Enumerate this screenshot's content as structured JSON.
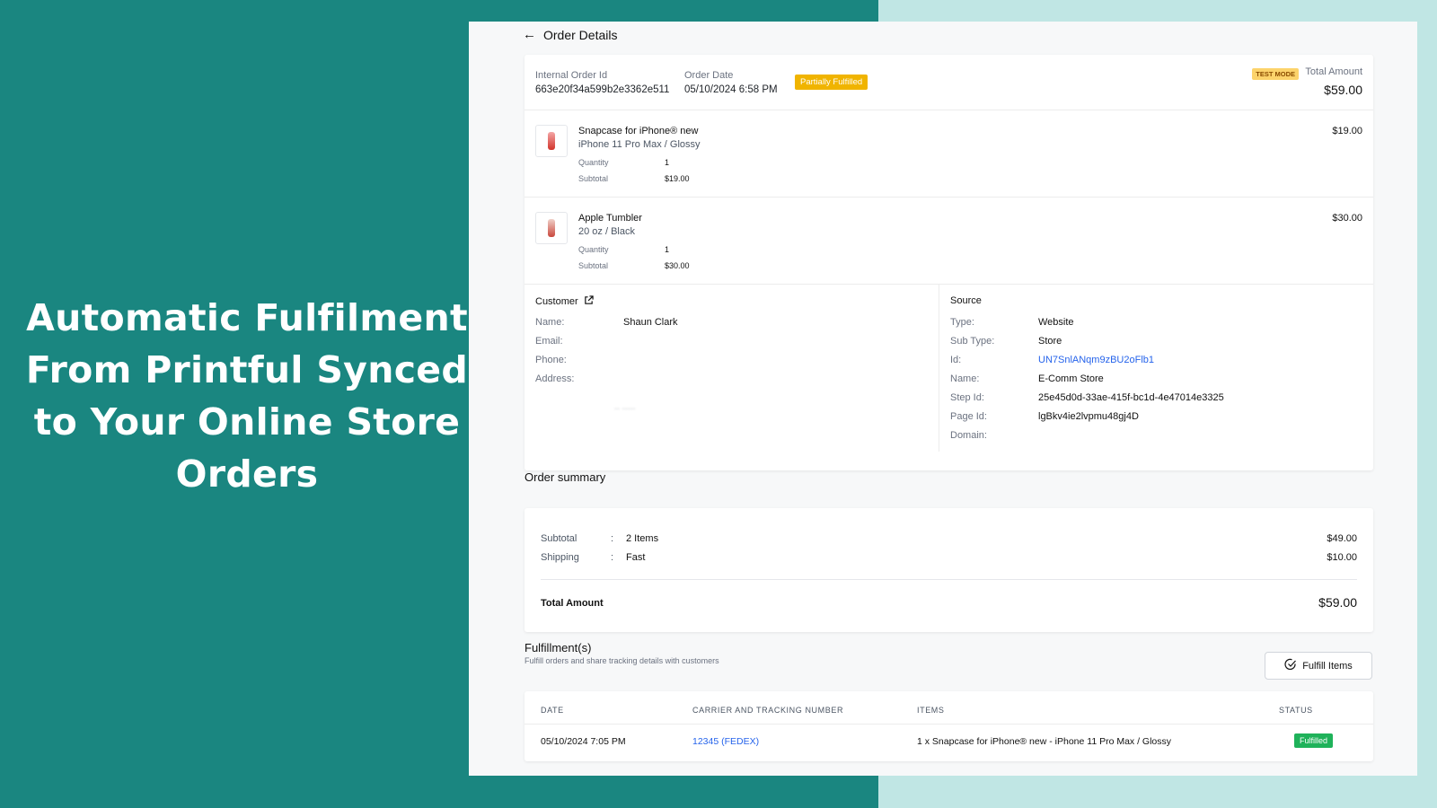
{
  "promo": {
    "headline": "Automatic Fulfilment From Printful Synced to Your Online Store Orders"
  },
  "header": {
    "back_icon": "arrow-left-icon",
    "title": "Order Details"
  },
  "order": {
    "internal_id_label": "Internal Order Id",
    "internal_id": "663e20f34a599b2e3362e511",
    "date_label": "Order Date",
    "date": "05/10/2024 6:58 PM",
    "status": "Partially Fulfilled",
    "test_mode": "TEST MODE",
    "total_label": "Total Amount",
    "total": "$59.00",
    "items": [
      {
        "name": "Snapcase for iPhone® new",
        "variant": "iPhone 11 Pro Max / Glossy",
        "qty_label": "Quantity",
        "qty": "1",
        "subtotal_label": "Subtotal",
        "subtotal": "$19.00",
        "price": "$19.00"
      },
      {
        "name": "Apple Tumbler",
        "variant": "20 oz / Black",
        "qty_label": "Quantity",
        "qty": "1",
        "subtotal_label": "Subtotal",
        "subtotal": "$30.00",
        "price": "$30.00"
      }
    ],
    "colors": {
      "partial_badge": "#f0b400",
      "fulfilled_badge": "#1fb25a",
      "link": "#2563eb",
      "brand_teal": "#1a8680"
    }
  },
  "customer": {
    "title": "Customer",
    "link_icon": "external-link-icon",
    "name_label": "Name:",
    "name": "Shaun Clark",
    "email_label": "Email:",
    "email": "",
    "phone_label": "Phone:",
    "phone": "",
    "address_label": "Address:",
    "address": "",
    "address_blur": "-- -----"
  },
  "source": {
    "title": "Source",
    "type_label": "Type:",
    "type": "Website",
    "subtype_label": "Sub Type:",
    "subtype": "Store",
    "id_label": "Id:",
    "id": "UN7SnlANqm9zBU2oFlb1",
    "name_label": "Name:",
    "name": "E-Comm Store",
    "step_label": "Step Id:",
    "step": "25e45d0d-33ae-415f-bc1d-4e47014e3325",
    "page_label": "Page Id:",
    "page": "lgBkv4ie2lvpmu48gj4D",
    "domain_label": "Domain:",
    "domain": ""
  },
  "summary": {
    "title": "Order summary",
    "subtotal_label": "Subtotal",
    "subtotal_detail": "2 Items",
    "subtotal_amount": "$49.00",
    "shipping_label": "Shipping",
    "shipping_detail": "Fast",
    "shipping_amount": "$10.00",
    "colon": ":",
    "total_label": "Total Amount",
    "total_amount": "$59.00"
  },
  "fulfillment": {
    "title": "Fulfillment(s)",
    "subtitle": "Fulfill orders and share tracking details with customers",
    "button_label": "Fulfill Items",
    "button_icon": "check-circle-icon",
    "columns": [
      "DATE",
      "CARRIER AND TRACKING NUMBER",
      "ITEMS",
      "STATUS"
    ],
    "rows": [
      {
        "date": "05/10/2024 7:05 PM",
        "tracking": "12345 (FEDEX)",
        "items": "1 x Snapcase for iPhone® new - iPhone 11 Pro Max / Glossy",
        "status": "Fulfilled"
      }
    ]
  }
}
